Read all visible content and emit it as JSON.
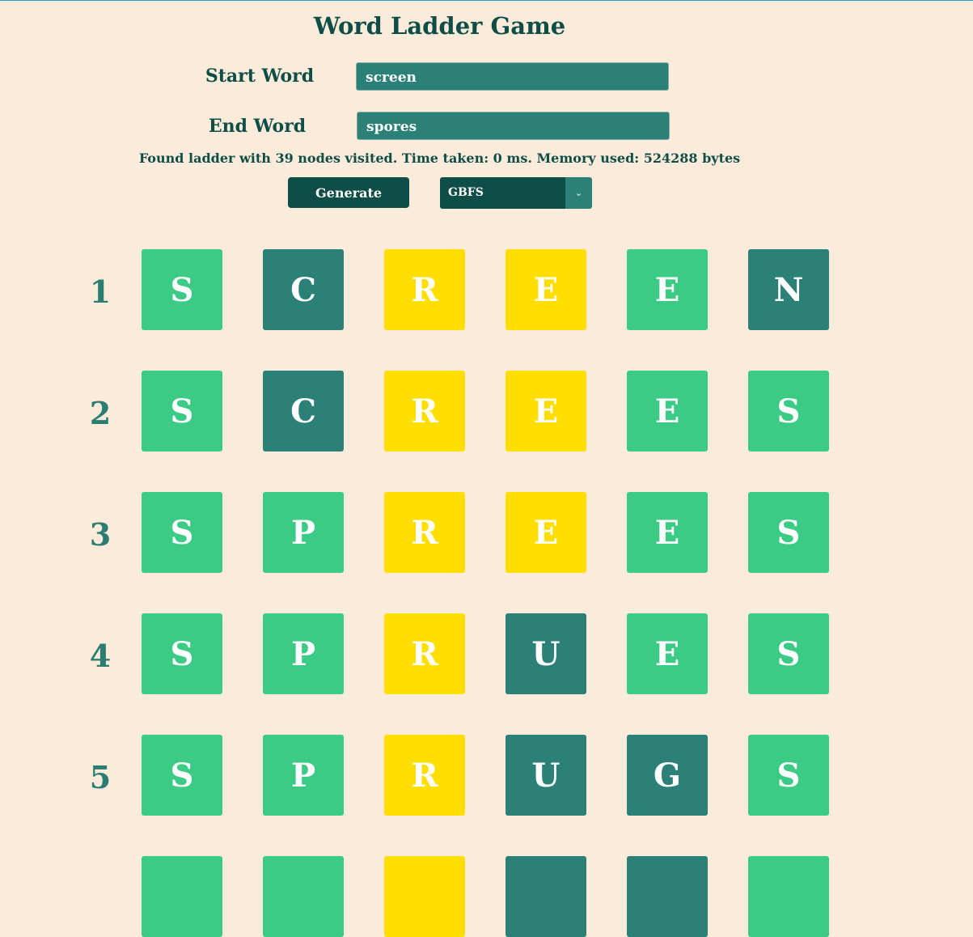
{
  "app": {
    "title": "Word Ladder Game"
  },
  "form": {
    "start_label": "Start Word",
    "start_value": "screen",
    "end_label": "End Word",
    "end_value": "spores",
    "generate_label": "Generate",
    "algorithm_selected": "GBFS",
    "algorithm_arrow_icon": "chevron-down-icon"
  },
  "status": "Found ladder with 39 nodes visited. Time taken: 0 ms. Memory used: 524288 bytes",
  "colors": {
    "green": "#3bcb84",
    "teal": "#2b8178",
    "yellow": "#ffde00"
  },
  "ladder": [
    {
      "num": "1",
      "letters": [
        "S",
        "C",
        "R",
        "E",
        "E",
        "N"
      ],
      "states": [
        "green",
        "teal",
        "yellow",
        "yellow",
        "green",
        "teal"
      ]
    },
    {
      "num": "2",
      "letters": [
        "S",
        "C",
        "R",
        "E",
        "E",
        "S"
      ],
      "states": [
        "green",
        "teal",
        "yellow",
        "yellow",
        "green",
        "green"
      ]
    },
    {
      "num": "3",
      "letters": [
        "S",
        "P",
        "R",
        "E",
        "E",
        "S"
      ],
      "states": [
        "green",
        "green",
        "yellow",
        "yellow",
        "green",
        "green"
      ]
    },
    {
      "num": "4",
      "letters": [
        "S",
        "P",
        "R",
        "U",
        "E",
        "S"
      ],
      "states": [
        "green",
        "green",
        "yellow",
        "teal",
        "green",
        "green"
      ]
    },
    {
      "num": "5",
      "letters": [
        "S",
        "P",
        "R",
        "U",
        "G",
        "S"
      ],
      "states": [
        "green",
        "green",
        "yellow",
        "teal",
        "teal",
        "green"
      ]
    },
    {
      "num": "",
      "letters": [
        "",
        "",
        "",
        "",
        "",
        ""
      ],
      "states": [
        "green",
        "green",
        "yellow",
        "teal",
        "teal",
        "green"
      ]
    }
  ]
}
